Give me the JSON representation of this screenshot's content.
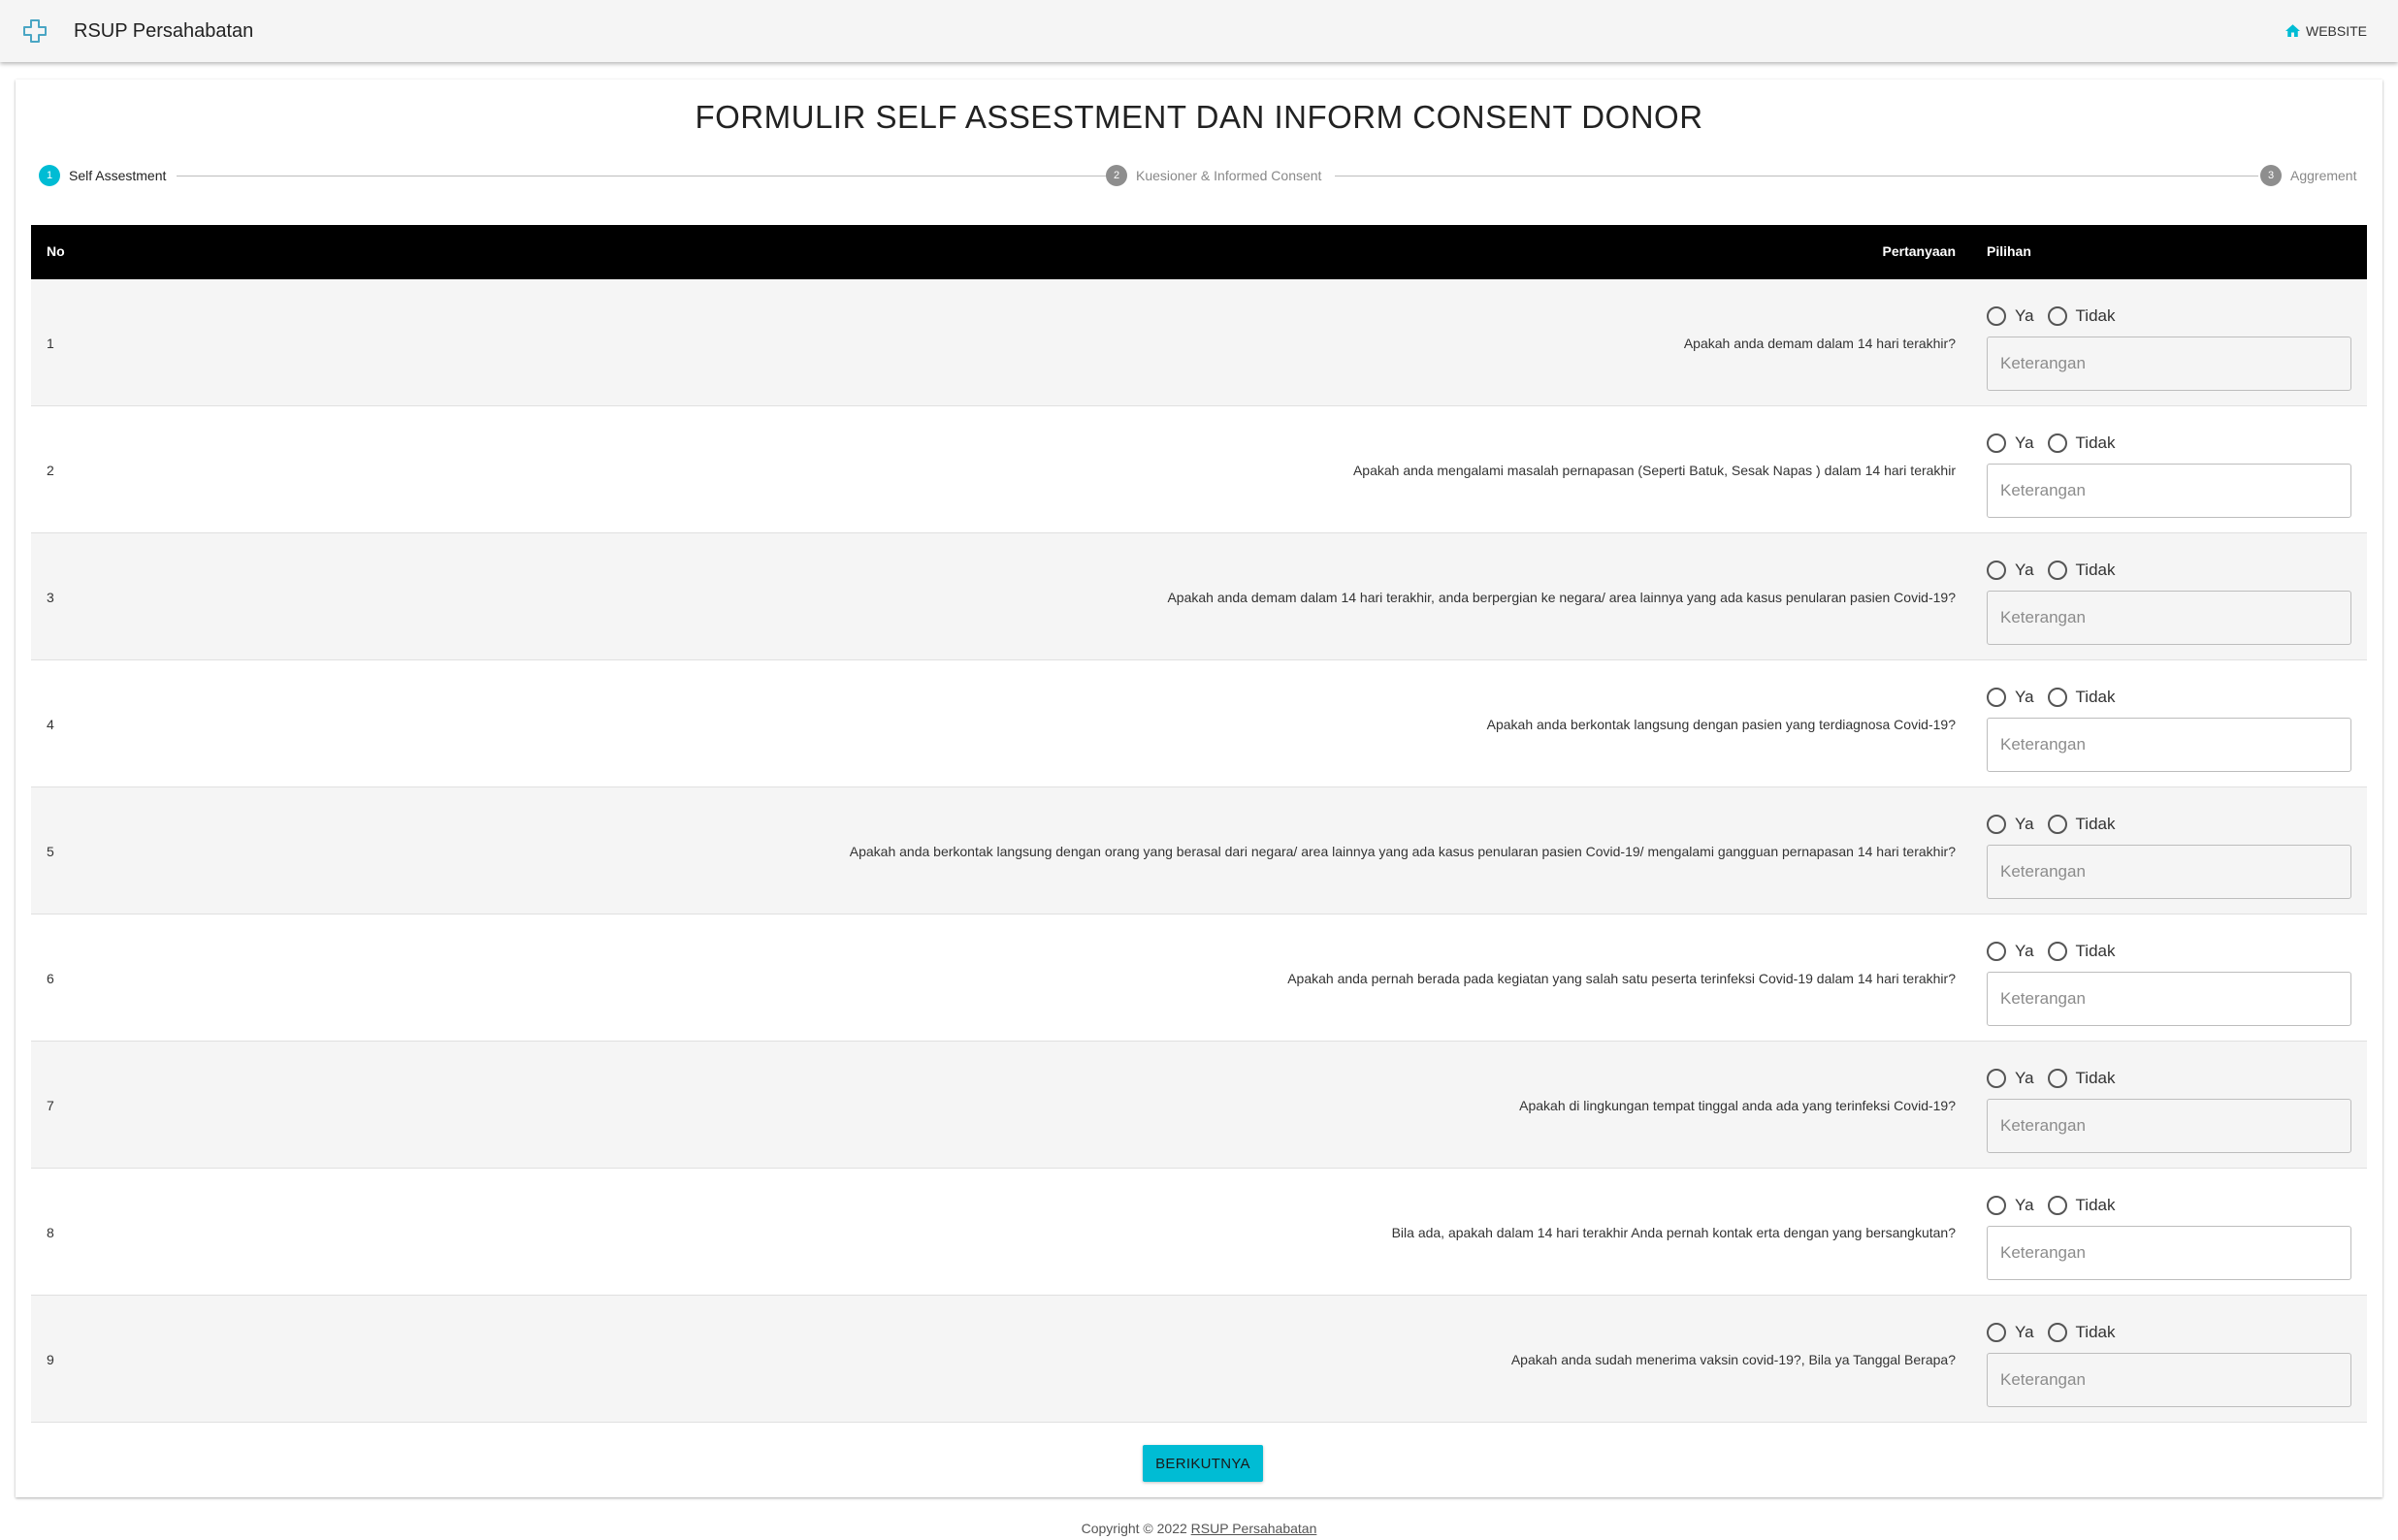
{
  "header": {
    "brand_name": "RSUP Persahabatan",
    "brand_icon": "medical-cross-icon",
    "website_label": "WEBSITE",
    "website_icon": "home-icon",
    "accent_color": "#00bcd4"
  },
  "page": {
    "title": "FORMULIR SELF ASSESTMENT DAN INFORM CONSENT DONOR"
  },
  "stepper": {
    "steps": [
      {
        "num": "1",
        "label": "Self Assestment",
        "active": true
      },
      {
        "num": "2",
        "label": "Kuesioner & Informed Consent",
        "active": false
      },
      {
        "num": "3",
        "label": "Aggrement",
        "active": false
      }
    ]
  },
  "table": {
    "headers": {
      "no": "No",
      "question": "Pertanyaan",
      "choice": "Pilihan"
    },
    "option_yes": "Ya",
    "option_no": "Tidak",
    "input_placeholder": "Keterangan",
    "rows": [
      {
        "no": "1",
        "question": "Apakah anda demam dalam 14 hari terakhir?"
      },
      {
        "no": "2",
        "question": "Apakah anda mengalami masalah pernapasan (Seperti Batuk, Sesak Napas ) dalam 14 hari terakhir"
      },
      {
        "no": "3",
        "question": "Apakah anda demam dalam 14 hari terakhir, anda berpergian ke negara/ area lainnya yang ada kasus penularan pasien Covid-19?"
      },
      {
        "no": "4",
        "question": "Apakah anda berkontak langsung dengan pasien yang terdiagnosa Covid-19?"
      },
      {
        "no": "5",
        "question": "Apakah anda berkontak langsung dengan orang yang berasal dari negara/ area lainnya yang ada kasus penularan pasien Covid-19/ mengalami gangguan pernapasan 14 hari terakhir?"
      },
      {
        "no": "6",
        "question": "Apakah anda pernah berada pada kegiatan yang salah satu peserta terinfeksi Covid-19 dalam 14 hari terakhir?"
      },
      {
        "no": "7",
        "question": "Apakah di lingkungan tempat tinggal anda ada yang terinfeksi Covid-19?"
      },
      {
        "no": "8",
        "question": "Bila ada, apakah dalam 14 hari terakhir Anda pernah kontak erta dengan yang bersangkutan?"
      },
      {
        "no": "9",
        "question": "Apakah anda sudah menerima vaksin covid-19?, Bila ya Tanggal Berapa?"
      }
    ]
  },
  "actions": {
    "next_label": "BERIKUTNYA"
  },
  "footer": {
    "copyright": "Copyright © 2022",
    "link_label": "RSUP Persahabatan"
  }
}
